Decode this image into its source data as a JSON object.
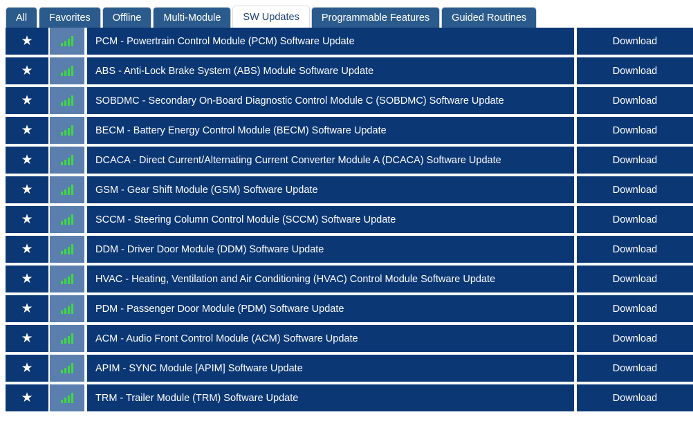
{
  "tabs": [
    {
      "label": "All",
      "active": false
    },
    {
      "label": "Favorites",
      "active": false
    },
    {
      "label": "Offline",
      "active": false
    },
    {
      "label": "Multi-Module",
      "active": false
    },
    {
      "label": "SW Updates",
      "active": true
    },
    {
      "label": "Programmable Features",
      "active": false
    },
    {
      "label": "Guided Routines",
      "active": false
    }
  ],
  "colors": {
    "tab_inactive_bg": "#2b5b8c",
    "tab_active_bg": "#ffffff",
    "tab_active_text": "#18407a",
    "row_bg": "#0b3775",
    "signal_cell_bg": "#5a7fae",
    "signal_bar": "#3ddb3d",
    "page_bg": "#ffffff"
  },
  "icons": {
    "favorite": "star-icon",
    "signal": "signal-strength-icon"
  },
  "row_action_label": "Download",
  "rows": [
    {
      "name": "PCM - Powertrain Control Module (PCM) Software Update",
      "action": "Download"
    },
    {
      "name": "ABS - Anti-Lock Brake System (ABS) Module Software Update",
      "action": "Download"
    },
    {
      "name": "SOBDMC - Secondary On-Board Diagnostic Control Module C (SOBDMC) Software Update",
      "action": "Download"
    },
    {
      "name": "BECM - Battery Energy Control Module (BECM) Software Update",
      "action": "Download"
    },
    {
      "name": "DCACA - Direct Current/Alternating Current Converter Module A (DCACA) Software Update",
      "action": "Download"
    },
    {
      "name": "GSM - Gear Shift Module (GSM) Software Update",
      "action": "Download"
    },
    {
      "name": "SCCM - Steering Column Control Module (SCCM) Software Update",
      "action": "Download"
    },
    {
      "name": "DDM - Driver Door Module (DDM) Software Update",
      "action": "Download"
    },
    {
      "name": "HVAC - Heating, Ventilation and Air Conditioning (HVAC) Control Module Software Update",
      "action": "Download"
    },
    {
      "name": "PDM - Passenger Door Module (PDM) Software Update",
      "action": "Download"
    },
    {
      "name": "ACM - Audio Front Control Module (ACM) Software Update",
      "action": "Download"
    },
    {
      "name": "APIM - SYNC Module [APIM] Software Update",
      "action": "Download"
    },
    {
      "name": "TRM - Trailer Module (TRM) Software Update",
      "action": "Download"
    }
  ]
}
